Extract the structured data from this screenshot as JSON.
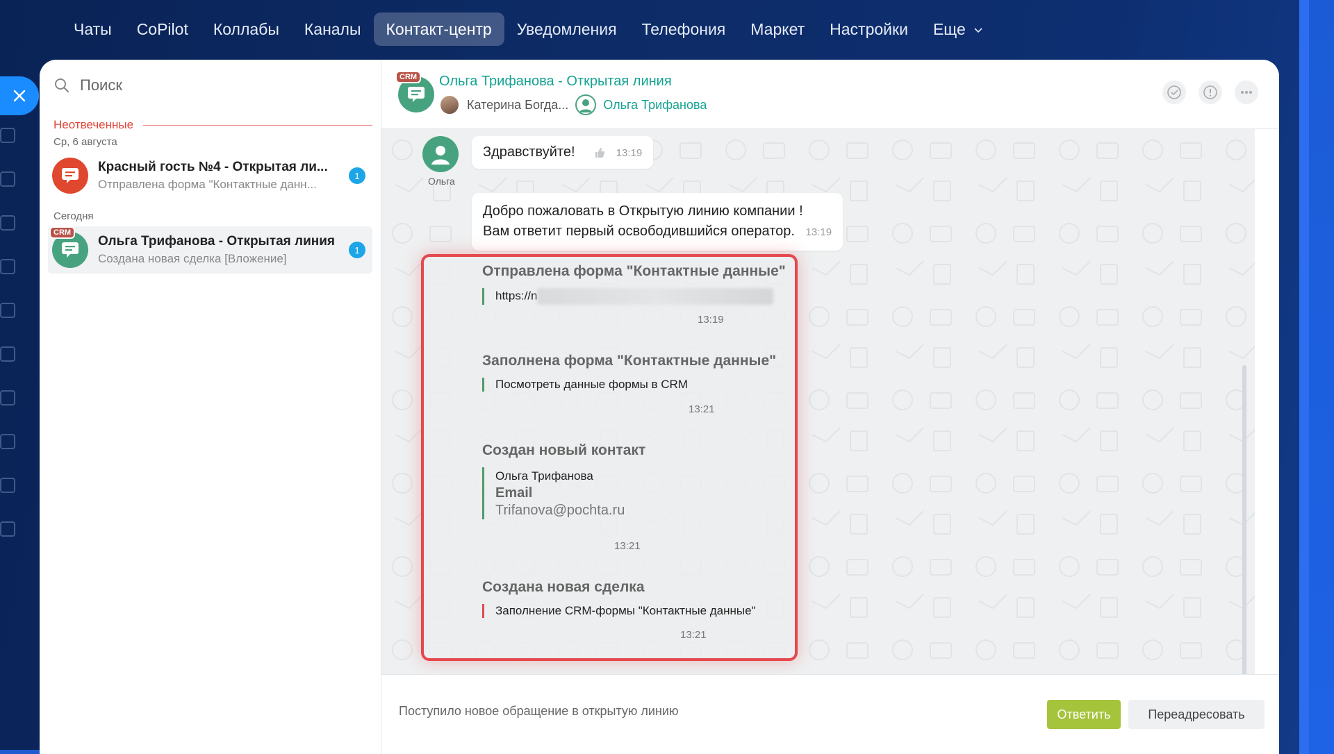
{
  "nav": {
    "items": [
      "Чаты",
      "CoPilot",
      "Коллабы",
      "Каналы",
      "Контакт-центр",
      "Уведомления",
      "Телефония",
      "Маркет",
      "Настройки",
      "Еще"
    ],
    "active_index": 4
  },
  "search": {
    "placeholder": "Поиск"
  },
  "sections": {
    "unanswered": "Неотвеченные",
    "date1": "Ср, 6 августа",
    "today": "Сегодня"
  },
  "chats": [
    {
      "title": "Красный гость №4 - Открытая ли...",
      "subtitle": "Отправлена форма \"Контактные данн...",
      "count": "1",
      "avatar_color": "#e0472f"
    },
    {
      "title": "Ольга Трифанова - Открытая линия",
      "subtitle": "Создана новая сделка [Вложение]",
      "count": "1",
      "badge": "CRM",
      "avatar_color": "#47a37f"
    }
  ],
  "header": {
    "badge": "CRM",
    "title": "Ольга Трифанова - Открытая линия",
    "operator": "Катерина Богда...",
    "client": "Ольга Трифанова"
  },
  "messages": {
    "sender": "Ольга",
    "greeting": {
      "text": "Здравствуйте!",
      "time": "13:19"
    },
    "welcome": {
      "line1": "Добро пожаловать в Открытую линию компании !",
      "line2": "Вам ответит первый освободившийся оператор.",
      "time": "13:19"
    },
    "system": [
      {
        "title": "Отправлена форма \"Контактные данные\"",
        "body": "https://n",
        "time": "13:19"
      },
      {
        "title": "Заполнена форма \"Контактные данные\"",
        "body": "Посмотреть данные формы в CRM",
        "time": "13:21"
      },
      {
        "title": "Создан новый контакт",
        "name": "Ольга Трифанова",
        "field_label": "Email",
        "field_value": "Trifanova@pochta.ru",
        "time": "13:21"
      },
      {
        "title": "Создана новая сделка",
        "body": "Заполнение CRM-формы \"Контактные данные\"",
        "time": "13:21"
      }
    ]
  },
  "footer": {
    "notice": "Поступило новое обращение в открытую линию",
    "reply": "Ответить",
    "forward": "Переадресовать"
  },
  "colors": {
    "accent_teal": "#15a392",
    "reply_green": "#a5c33b",
    "highlight_red": "#e5484d",
    "badge_blue": "#1ca6e8"
  }
}
